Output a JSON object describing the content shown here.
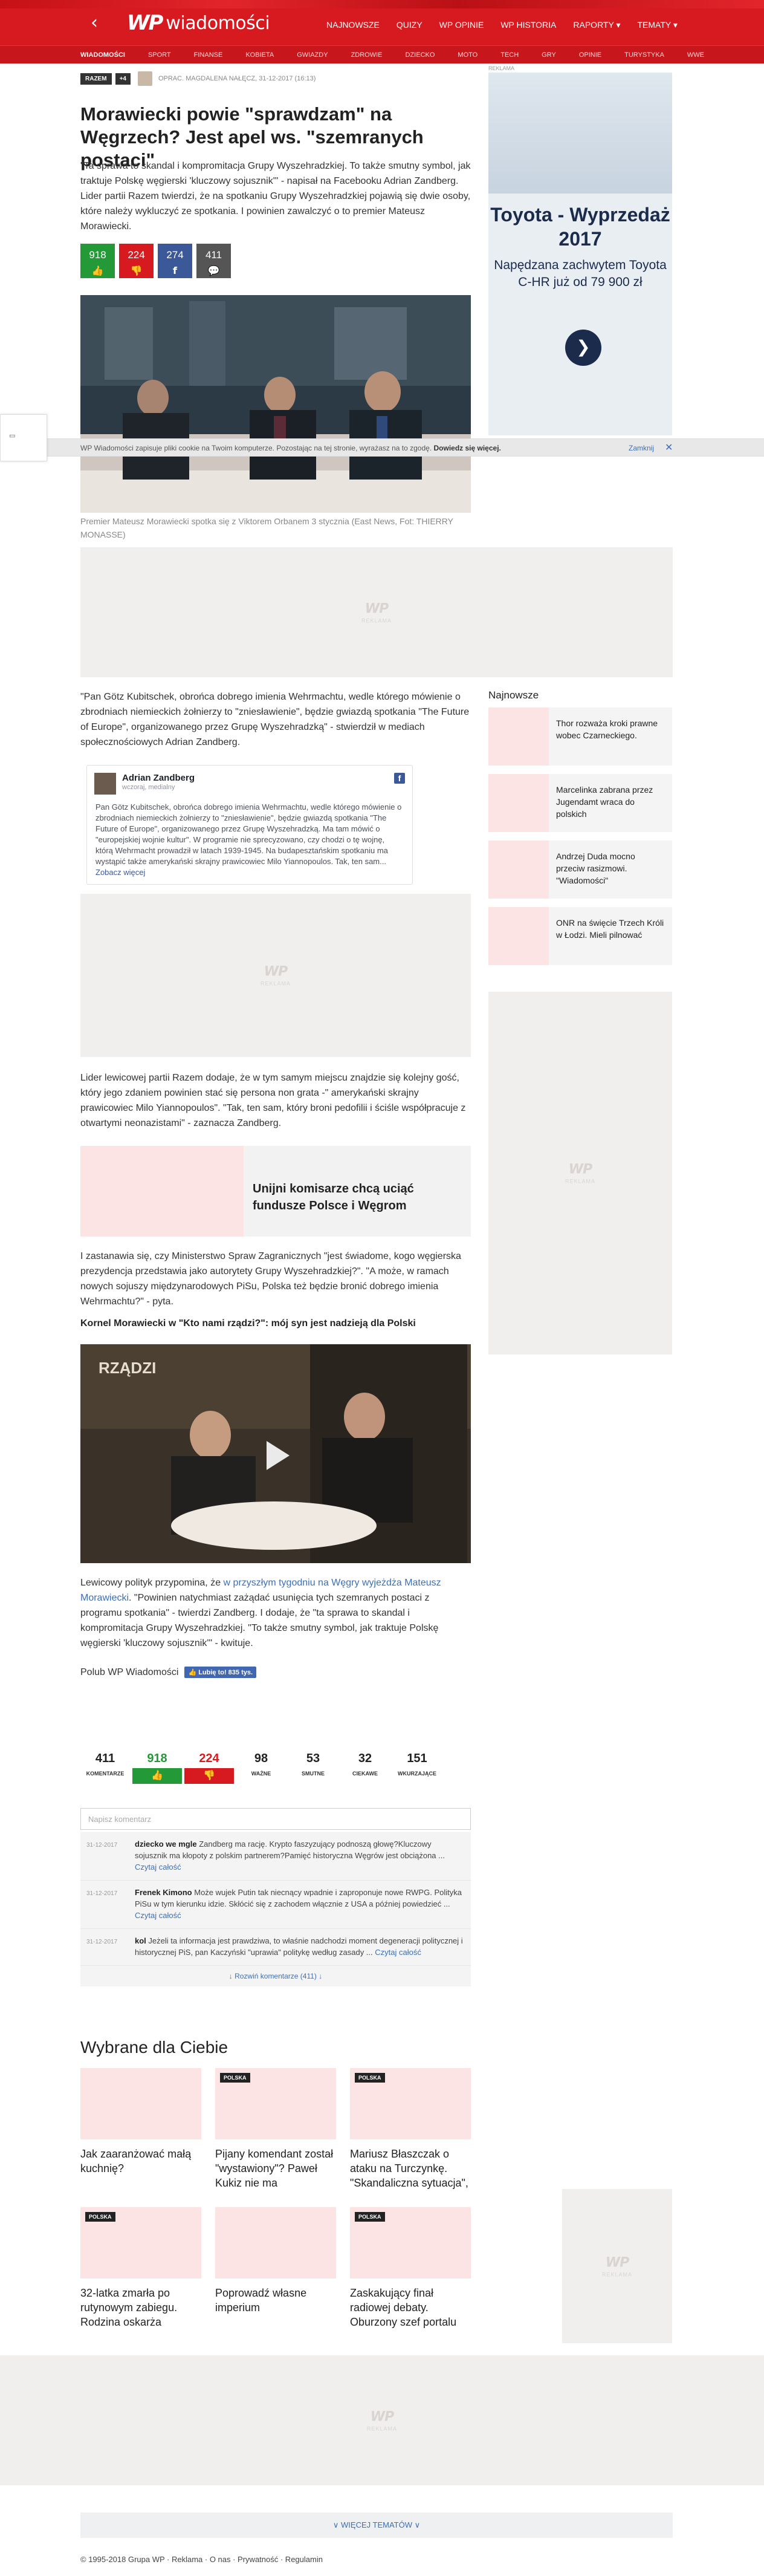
{
  "header": {
    "logo": "wiadomości",
    "logo_mark": "WP",
    "nav": [
      "NAJNOWSZE",
      "QUIZY",
      "WP OPINIE",
      "WP HISTORIA",
      "RAPORTY ▾",
      "TEMATY ▾"
    ],
    "subnav": [
      "WIADOMOŚCI",
      "SPORT",
      "FINANSE",
      "KOBIETA",
      "GWIAZDY",
      "ZDROWIE",
      "DZIECKO",
      "MOTO",
      "TECH",
      "GRY",
      "OPINIE",
      "TURYSTYKA",
      "WWE"
    ]
  },
  "article": {
    "tag": "RAZEM",
    "tag_plus": "+4",
    "meta": "OPRAC. MAGDALENA NAŁĘCZ, 31-12-2017 (16:13)",
    "title": "Morawiecki powie \"sprawdzam\" na Węgrzech? Jest apel ws. \"szemranych postaci\"",
    "lead": "\"Ta sprawa to skandal i kompromitacja Grupy Wyszehradzkiej. To także smutny symbol, jak traktuje Polskę węgierski 'kluczowy sojusznik'\" - napisał na Facebooku Adrian Zandberg. Lider partii Razem twierdzi, że na spotkaniu Grupy Wyszehradzkiej pojawią się dwie osoby, które należy wykluczyć ze spotkania. I powinien zawalczyć o to premier Mateusz Morawiecki.",
    "share": [
      {
        "count": "918",
        "icon": "👍",
        "color": "#249937"
      },
      {
        "count": "224",
        "icon": "👎",
        "color": "#d71920"
      },
      {
        "count": "274",
        "icon": "f",
        "color": "#3b5998"
      },
      {
        "count": "411",
        "icon": "💬",
        "color": "#555555"
      }
    ],
    "caption": "Premier Mateusz Morawiecki spotka się z Viktorem Orbanem 3 stycznia (East News, Fot: THIERRY MONASSE)",
    "p1": "\"Pan Götz Kubitschek, obrońca dobrego imienia Wehrmachtu, wedle którego mówienie o zbrodniach niemieckich żołnierzy to \"zniesławienie\", będzie gwiazdą spotkania \"The Future of Europe\", organizowanego przez Grupę Wyszehradzką\" - stwierdził w mediach społecznościowych Adrian Zandberg.",
    "fb": {
      "name": "Adrian Zandberg",
      "sub": "wczoraj, medialny",
      "text": "Pan Götz Kubitschek, obrońca dobrego imienia Wehrmachtu, wedle którego mówienie o zbrodniach niemieckich żołnierzy to \"zniesławienie\", będzie gwiazdą spotkania \"The Future of Europe\", organizowanego przez Grupę Wyszehradzką. Ma tam mówić o \"europejskiej wojnie kultur\". W programie nie sprecyzowano, czy chodzi o tę wojnę, którą Wehrmacht prowadził w latach 1939-1945. Na budapesztańskim spotkaniu ma wystąpić także amerykański skrajny prawicowiec Milo Yiannopoulos. Tak, ten sam...",
      "more": "Zobacz więcej"
    },
    "p2": "Lider lewicowej partii Razem dodaje, że w tym samym miejscu znajdzie się kolejny gość, który jego zdaniem powinien stać się persona non grata -\" amerykański skrajny prawicowiec Milo Yiannopoulos\". \"Tak, ten sam, który broni pedofilii i ściśle współpracuje z otwartymi neonazistami\" - zaznacza Zandberg.",
    "teaser": "Unijni komisarze chcą uciąć fundusze Polsce i Węgrom",
    "p3": "I zastanawia się, czy Ministerstwo Spraw Zagranicznych \"jest świadome, kogo węgierska prezydencja przedstawia jako autorytety Grupy Wyszehradzkiej?\". \"A może, w ramach nowych sojuszy międzynarodowych PiSu, Polska też będzie bronić dobrego imienia Wehrmachtu?\" - pyta.",
    "subhead": "Kornel Morawiecki w \"Kto nami rządzi?\": mój syn jest nadzieją dla Polski",
    "p4_a": "Lewicowy polityk przypomina, że ",
    "p4_link": "w przyszłym tygodniu na Węgry wyjeżdża Mateusz Morawiecki",
    "p4_b": ". \"Powinien natychmiast zażądać usunięcia tych szemranych postaci z programu spotkania\" - twierdzi Zandberg. I dodaje, że \"ta sprawa to skandal i kompromitacja Grupy Wyszehradzkiej. \"To także smutny symbol, jak traktuje Polskę węgierski 'kluczowy sojusznik'\" - kwituje.",
    "like_label": "Polub WP Wiadomości",
    "like_btn": "👍 Lubię to! 835 tys."
  },
  "ad_label": "WP",
  "ad_sub": "REKLAMA",
  "reactions": [
    {
      "num": "411",
      "label": "KOMENTARZE",
      "kind": "plain"
    },
    {
      "num": "918",
      "label": "👍",
      "kind": "up"
    },
    {
      "num": "224",
      "label": "👎",
      "kind": "down"
    },
    {
      "num": "98",
      "label": "WAŻNE",
      "kind": "plain"
    },
    {
      "num": "53",
      "label": "SMUTNE",
      "kind": "plain"
    },
    {
      "num": "32",
      "label": "CIEKAWE",
      "kind": "plain"
    },
    {
      "num": "151",
      "label": "WKURZAJĄCE",
      "kind": "plain"
    }
  ],
  "comments": {
    "placeholder": "Napisz komentarz",
    "items": [
      {
        "date": "31-12-2017",
        "user": "dziecko we mgle",
        "text": "Zandberg ma rację. Krypto faszyzujący podnoszą głowę?Kluczowy sojusznik ma kłopoty z polskim partnerem?Pamięć historyczna Węgrów jest obciążona ...",
        "more": "Czytaj całość"
      },
      {
        "date": "31-12-2017",
        "user": "Frenek Kimono",
        "text": "Może wujek Putin tak niecnący wpadnie i zaproponuje nowe RWPG. Polityka PiSu w tym kierunku idzie. Skłócić się z zachodem włącznie z USA a później powiedzieć ...",
        "more": "Czytaj całość"
      },
      {
        "date": "31-12-2017",
        "user": "kol",
        "text": "Jeżeli ta informacja jest prawdziwa, to właśnie nadchodzi moment degeneracji politycznej i historycznej PiS, pan Kaczyński \"uprawia\" politykę według zasady ...",
        "more": "Czytaj całość"
      }
    ],
    "expand": "↓ Rozwiń komentarze (411) ↓"
  },
  "recommended": {
    "title": "Wybrane dla Ciebie",
    "items": [
      {
        "title": "Jak zaaranżować małą kuchnię?",
        "badge": ""
      },
      {
        "title": "Pijany komendant został \"wystawiony\"? Paweł Kukiz nie ma",
        "badge": "POLSKA"
      },
      {
        "title": "Mariusz Błaszczak o ataku na Turczynkę. \"Skandaliczna sytuacja\",",
        "badge": "POLSKA"
      },
      {
        "title": "32-latka zmarła po rutynowym zabiegu. Rodzina oskarża",
        "badge": "POLSKA"
      },
      {
        "title": "Poprowadź własne imperium",
        "badge": ""
      },
      {
        "title": "Zaskakujący finał radiowej debaty. Oburzony szef portalu",
        "badge": "POLSKA"
      }
    ]
  },
  "sidebar": {
    "ad_label": "REKLAMA",
    "toyota_title": "Toyota - Wyprzedaż 2017",
    "toyota_sub": "Napędzana zachwytem Toyota C-HR już od 79 900 zł",
    "toyota_go": "❯",
    "news_head": "Najnowsze",
    "news": [
      "Thor rozważa kroki prawne wobec Czarneckiego.",
      "Marcelinka zabrana przez Jugendamt wraca do polskich",
      "Andrzej Duda mocno przeciw rasizmowi. \"Wiadomości\"",
      "ONR na święcie Trzech Króli w Łodzi. Mieli pilnować"
    ]
  },
  "cookie": {
    "text": "WP Wiadomości zapisuje pliki cookie na Twoim komputerze. Pozostając na tej stronie, wyrażasz na to zgodę.",
    "bold": "Dowiedz się więcej.",
    "close": "Zamknij",
    "x": "✕"
  },
  "side_tab_icon": "▭",
  "more_topics": "∨ WIĘCEJ TEMATÓW ∨",
  "footer": "© 1995-2018 Grupa WP  ·  Reklama  ·  O nas  ·  Prywatność  ·  Regulamin"
}
